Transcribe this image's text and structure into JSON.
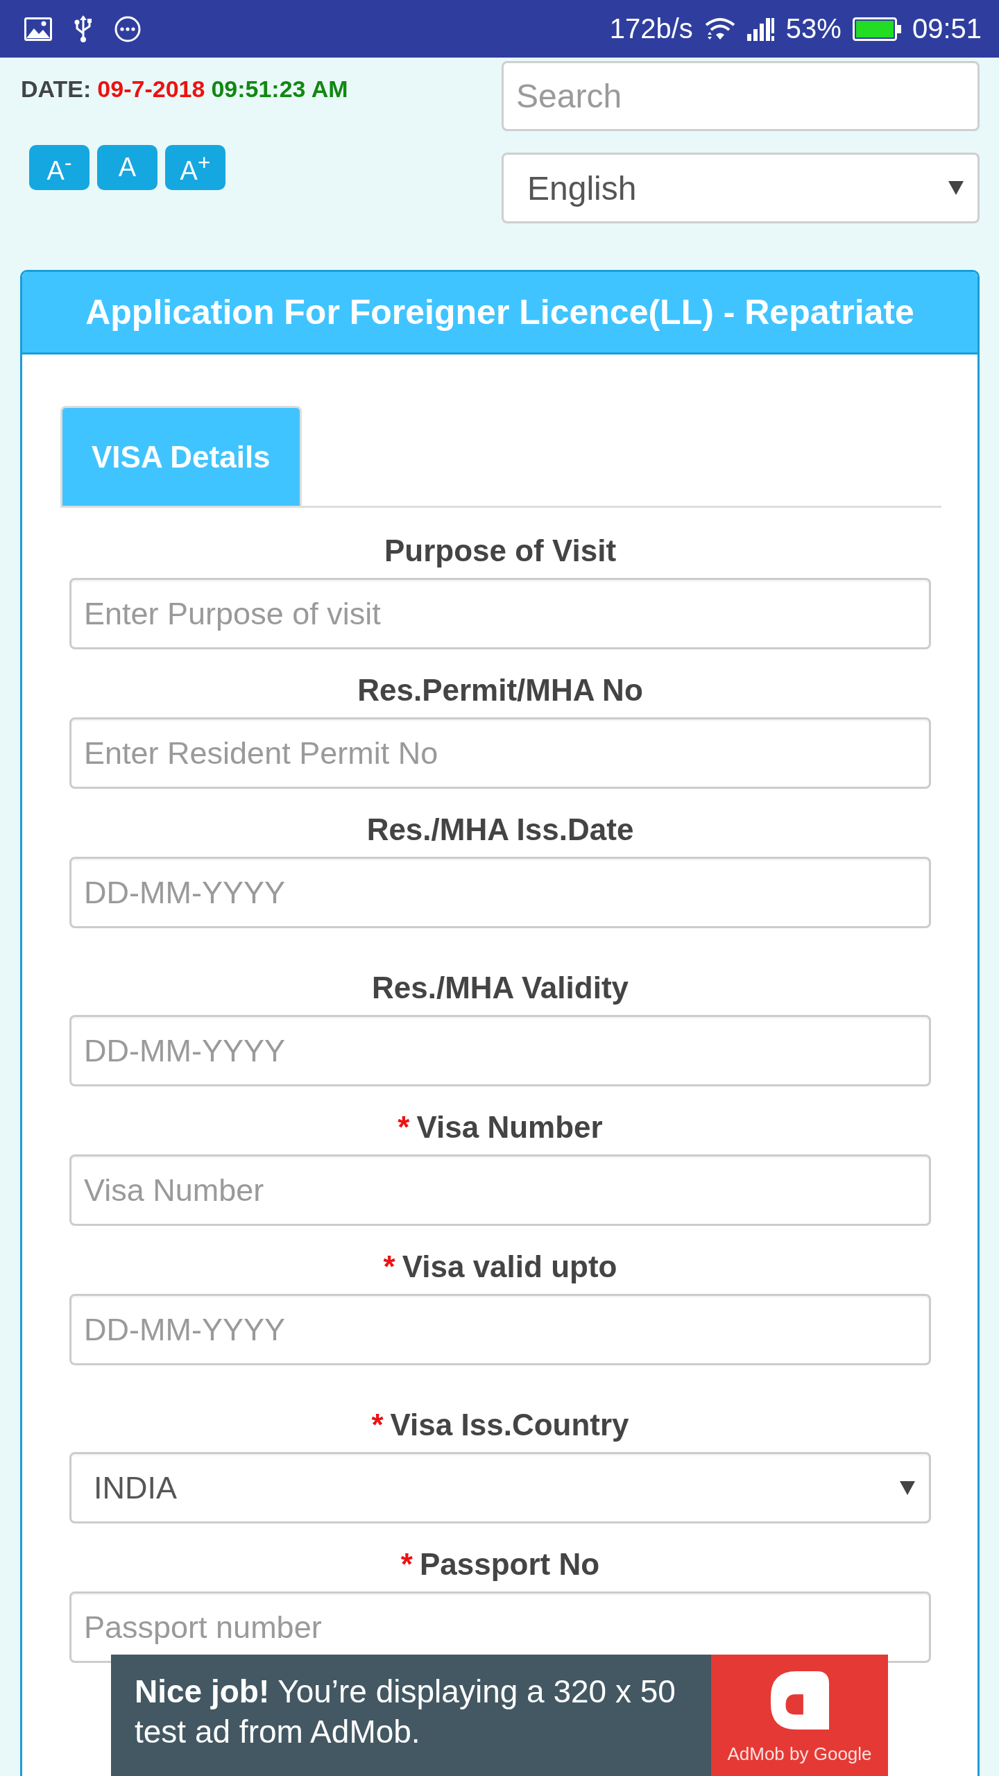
{
  "status_bar": {
    "speed": "172b/s",
    "battery": "53%",
    "time": "09:51"
  },
  "header": {
    "date_label": "DATE:",
    "date": "09-7-2018",
    "time": "09:51:23 AM",
    "font_buttons": [
      {
        "label": "A$^{-}$"
      },
      {
        "label": "A"
      },
      {
        "label": "A$^{+}$"
      }
    ],
    "search": {
      "placeholder": "Search"
    },
    "language": {
      "value": "English"
    }
  },
  "form": {
    "title": "Application For Foreigner Licence(LL) - Repatriate",
    "tabs": [
      {
        "label": "VISA Details",
        "selected": true
      }
    ],
    "fields": [
      {
        "kind": "input",
        "label": "Purpose of Visit",
        "placeholder": "Enter Purpose of visit"
      },
      {
        "kind": "input",
        "label": "Res.Permit/MHA No",
        "placeholder": "Enter Resident Permit No"
      },
      {
        "kind": "input",
        "label": "Res./MHA Iss.Date",
        "placeholder": "DD-MM-YYYY"
      },
      {
        "kind": "input",
        "label": "Res./MHA Validity",
        "placeholder": "DD-MM-YYYY"
      },
      {
        "kind": "input",
        "required_mark": "*",
        "label": "Visa Number",
        "placeholder": "Visa Number"
      },
      {
        "kind": "input",
        "required_mark": "*",
        "label": "Visa valid upto",
        "placeholder": "DD-MM-YYYY"
      },
      {
        "kind": "select",
        "required_mark": "*",
        "label": "Visa Iss.Country",
        "value": "INDIA"
      },
      {
        "kind": "input",
        "required_mark": "*",
        "label": "Passport No",
        "placeholder": "Passport number"
      }
    ]
  },
  "ad": {
    "text": "**Nice job!** You’re displaying a 320 x 50 test ad from AdMob.",
    "brand": "AdMob by Google"
  }
}
